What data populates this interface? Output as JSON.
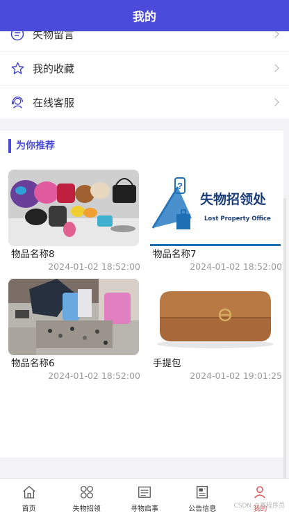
{
  "header": {
    "title": "我的"
  },
  "menu": {
    "items": [
      {
        "label": "失物留言",
        "icon": "message-icon"
      },
      {
        "label": "我的收藏",
        "icon": "star-icon"
      },
      {
        "label": "在线客服",
        "icon": "customer-service-icon"
      }
    ]
  },
  "recommend": {
    "title": "为你推荐",
    "items": [
      {
        "name": "物品名称8",
        "time": "2024-01-02 18:52:00",
        "image": "lost-items-photo"
      },
      {
        "name": "物品名称7",
        "time": "2024-01-02 18:52:00",
        "image": "lost-property-office-sign",
        "sign_cn": "失物招领处",
        "sign_en": "Lost Property Office"
      },
      {
        "name": "物品名称6",
        "time": "2024-01-02 18:52:00",
        "image": "lost-items-pile-photo"
      },
      {
        "name": "手提包",
        "time": "2024-01-02 19:01:25",
        "image": "brown-wallet-photo"
      }
    ]
  },
  "tabbar": {
    "items": [
      {
        "label": "首页",
        "icon": "home-icon",
        "active": false
      },
      {
        "label": "失物招领",
        "icon": "grid-icon",
        "active": false
      },
      {
        "label": "寻物启事",
        "icon": "notice-icon",
        "active": false
      },
      {
        "label": "公告信息",
        "icon": "news-icon",
        "active": false
      },
      {
        "label": "我的",
        "icon": "user-icon",
        "active": true
      }
    ]
  },
  "watermark": "CSDN @赛程序员",
  "colors": {
    "accent": "#4a4adb",
    "active_tab": "#e05050",
    "icon": "#3b3bc9"
  }
}
